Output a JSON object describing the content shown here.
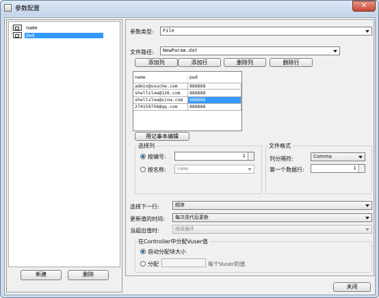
{
  "window": {
    "title": "参数配置",
    "close_glyph": "✕"
  },
  "left": {
    "tree": [
      {
        "label": "name",
        "selected": false
      },
      {
        "label": "pwd",
        "selected": true
      }
    ],
    "new_button": "新建",
    "delete_button": "删除"
  },
  "right": {
    "param_type_label": "参数类型:",
    "param_type_value": "File",
    "file_path_label": "文件路径:",
    "file_path_value": "NewParam.dat",
    "buttons": {
      "add_column": "添加列",
      "add_row": "添加行",
      "delete_column": "删除列",
      "delete_row": "删除行"
    },
    "table": {
      "headers": [
        "name",
        "pwd"
      ],
      "rows": [
        [
          "admin@souche.com",
          "888888"
        ],
        [
          "shellslow@126.com",
          "888888"
        ],
        [
          "shellslow@sina.com",
          "888888"
        ],
        [
          "274159756@qq.com",
          "888888"
        ]
      ],
      "selected_row": 2,
      "selected_col": 1
    },
    "edit_notepad_button": "用记事本编辑",
    "select_column": {
      "title": "选择列",
      "by_number_label": "按编号:",
      "by_number_value": "1",
      "by_name_label": "按名称:",
      "by_name_value": "name"
    },
    "file_format": {
      "title": "文件格式",
      "delimiter_label": "列分隔符:",
      "delimiter_value": "Comma",
      "first_row_label": "第一个数据行:",
      "first_row_value": "1"
    },
    "next_row_label": "选择下一行:",
    "next_row_value": "顺序",
    "update_label": "更新值的时间:",
    "update_value": "每次迭代后更新",
    "out_of_values_label": "当超出值时:",
    "out_of_values_value": "继续循环",
    "controller": {
      "title": "在Controller中分配Vuser值",
      "auto_label": "自动分配块大小",
      "allocate_label": "分配",
      "per_vuser_label": "每个Vuser的值"
    },
    "close_button": "关闭"
  }
}
